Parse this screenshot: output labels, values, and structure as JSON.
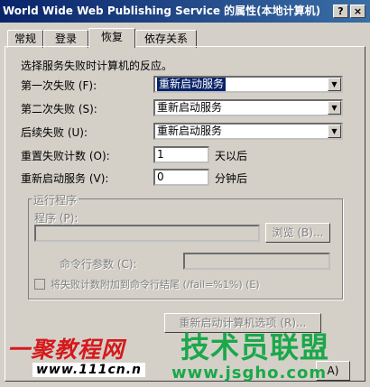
{
  "window": {
    "title": "World Wide Web Publishing Service 的属性(本地计算机)",
    "help_glyph": "?",
    "close_glyph": "×"
  },
  "tabs": [
    {
      "label": "常规"
    },
    {
      "label": "登录"
    },
    {
      "label": "恢复",
      "active": true
    },
    {
      "label": "依存关系"
    }
  ],
  "recovery": {
    "instruction": "选择服务失败时计算机的反应。",
    "first_failure": {
      "label": "第一次失败 (F):",
      "value": "重新启动服务"
    },
    "second_failure": {
      "label": "第二次失败 (S):",
      "value": "重新启动服务"
    },
    "subsequent_failures": {
      "label": "后续失败 (U):",
      "value": "重新启动服务"
    },
    "reset_count": {
      "label": "重置失败计数 (O):",
      "value": "1",
      "unit": "天以后"
    },
    "restart_service": {
      "label": "重新启动服务 (V):",
      "value": "0",
      "unit": "分钟后"
    }
  },
  "run_program": {
    "group_label": "运行程序",
    "program_label": "程序 (P):",
    "browse_label": "浏览 (B)...",
    "params_label": "命令行参数 (C):",
    "append_label": "将失败计数附加到命令行结尾 (/fail=%1%) (E)"
  },
  "restart_options_label": "重新启动计算机选项 (R)...",
  "bottom_partial": {
    "text": "A)"
  },
  "watermark": {
    "site1": "一聚教程网",
    "url1": "www.111cn.n",
    "site2": "技术员联盟",
    "url2": "www.jsgho.com"
  }
}
